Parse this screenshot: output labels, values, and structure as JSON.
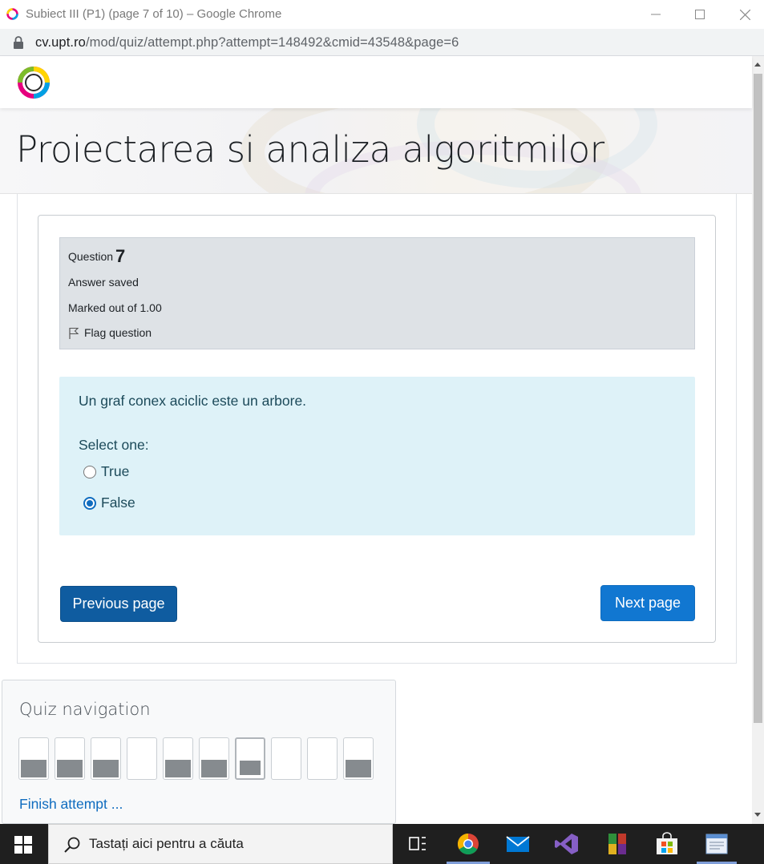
{
  "window": {
    "title": "Subiect III (P1) (page 7 of 10) – Google Chrome",
    "url_host": "cv.upt.ro",
    "url_path": "/mod/quiz/attempt.php?attempt=148492&cmid=43548&page=6"
  },
  "page": {
    "heading": "Proiectarea si analiza algoritmilor"
  },
  "question": {
    "label": "Question",
    "number": "7",
    "state": "Answer saved",
    "grade": "Marked out of 1.00",
    "flag_label": "Flag question",
    "text": "Un graf conex aciclic este un arbore.",
    "prompt": "Select one:",
    "options": [
      {
        "label": "True",
        "selected": false
      },
      {
        "label": "False",
        "selected": true
      }
    ]
  },
  "buttons": {
    "previous": "Previous page",
    "next": "Next page"
  },
  "quiz_navigation": {
    "title": "Quiz navigation",
    "questions": [
      {
        "answered": true,
        "current": false
      },
      {
        "answered": true,
        "current": false
      },
      {
        "answered": true,
        "current": false
      },
      {
        "answered": false,
        "current": false
      },
      {
        "answered": true,
        "current": false
      },
      {
        "answered": true,
        "current": false
      },
      {
        "answered": true,
        "current": true
      },
      {
        "answered": false,
        "current": false
      },
      {
        "answered": false,
        "current": false
      },
      {
        "answered": true,
        "current": false
      }
    ],
    "finish_label": "Finish attempt ..."
  },
  "taskbar": {
    "search_placeholder": "Tastați aici pentru a căuta",
    "icons": [
      "task-view-icon",
      "chrome-icon",
      "mail-icon",
      "visual-studio-icon",
      "winrar-icon",
      "store-icon",
      "notepad-icon"
    ]
  }
}
